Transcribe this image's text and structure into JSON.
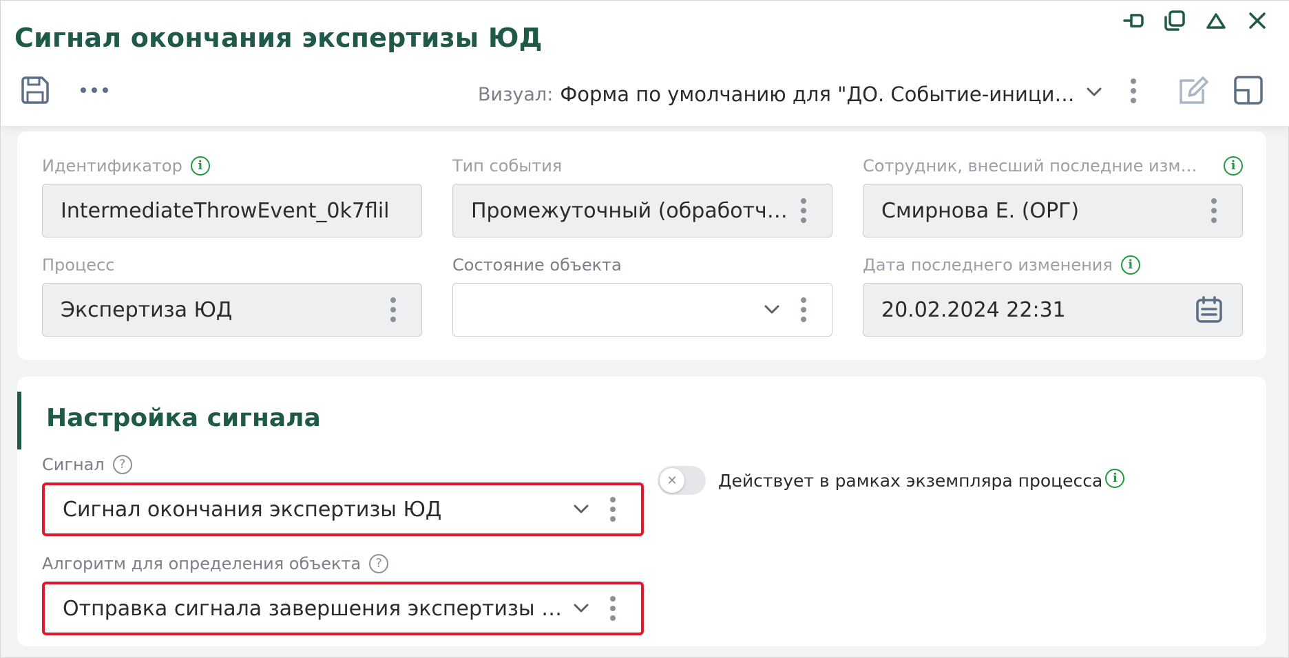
{
  "window": {
    "title": "Сигнал окончания экспертизы ЮД",
    "controls": [
      "pin-icon",
      "restore-icon",
      "collapse-icon",
      "close-icon"
    ]
  },
  "toolbar": {
    "save_icon": "floppy-disk-icon",
    "more_label": "•••",
    "visual_label": "Визуал:",
    "visual_value": "Форма по умолчанию для \"ДО. Событие-инициатор\""
  },
  "fields": {
    "identifier": {
      "label": "Идентификатор",
      "value": "IntermediateThrowEvent_0k7flil"
    },
    "event_type": {
      "label": "Тип события",
      "value": "Промежуточный (обработчик)"
    },
    "editor": {
      "label": "Сотрудник, внесший последние изменения",
      "value": "Смирнова Е. (ОРГ)"
    },
    "process": {
      "label": "Процесс",
      "value": "Экспертиза ЮД"
    },
    "object_state": {
      "label": "Состояние объекта",
      "value": ""
    },
    "last_modified": {
      "label": "Дата последнего изменения",
      "value": "20.02.2024 22:31"
    }
  },
  "signal_section": {
    "title": "Настройка сигнала",
    "signal": {
      "label": "Сигнал",
      "value": "Сигнал окончания экспертизы ЮД"
    },
    "algorithm": {
      "label": "Алгоритм для определения объекта",
      "value": "Отправка сигнала завершения экспертизы ЮД"
    },
    "toggle": {
      "label": "Действует в рамках экземпляра процесса",
      "state": "off"
    }
  },
  "colors": {
    "accent": "#1e5a47",
    "info": "#1f9a3c",
    "highlight": "#e0192d"
  }
}
